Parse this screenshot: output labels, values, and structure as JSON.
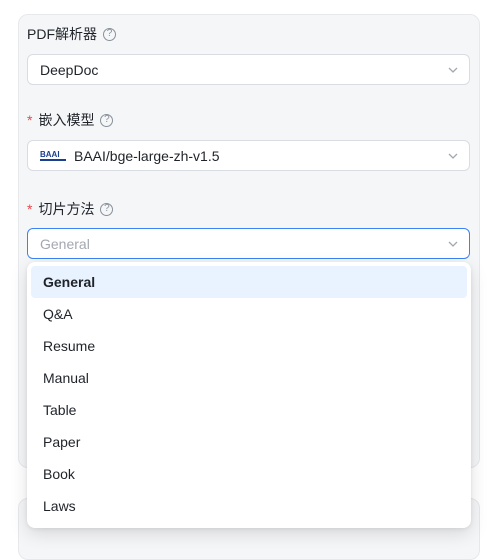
{
  "form": {
    "pdf_parser": {
      "label": "PDF解析器",
      "value": "DeepDoc"
    },
    "embedding_model": {
      "required_mark": "*",
      "label": "嵌入模型",
      "logo_text": "BAAI",
      "value": "BAAI/bge-large-zh-v1.5"
    },
    "chunk_method": {
      "required_mark": "*",
      "label": "切片方法",
      "placeholder": "General"
    }
  },
  "dropdown": {
    "options": [
      "General",
      "Q&A",
      "Resume",
      "Manual",
      "Table",
      "Paper",
      "Book",
      "Laws"
    ],
    "selected": "General"
  },
  "icons": {
    "help": "help-circle-icon",
    "chevron": "chevron-down-icon",
    "logo": "baai-logo-icon"
  },
  "colors": {
    "accent": "#3b82f6",
    "required": "#e5484d",
    "selected_bg": "#e8f3ff"
  }
}
